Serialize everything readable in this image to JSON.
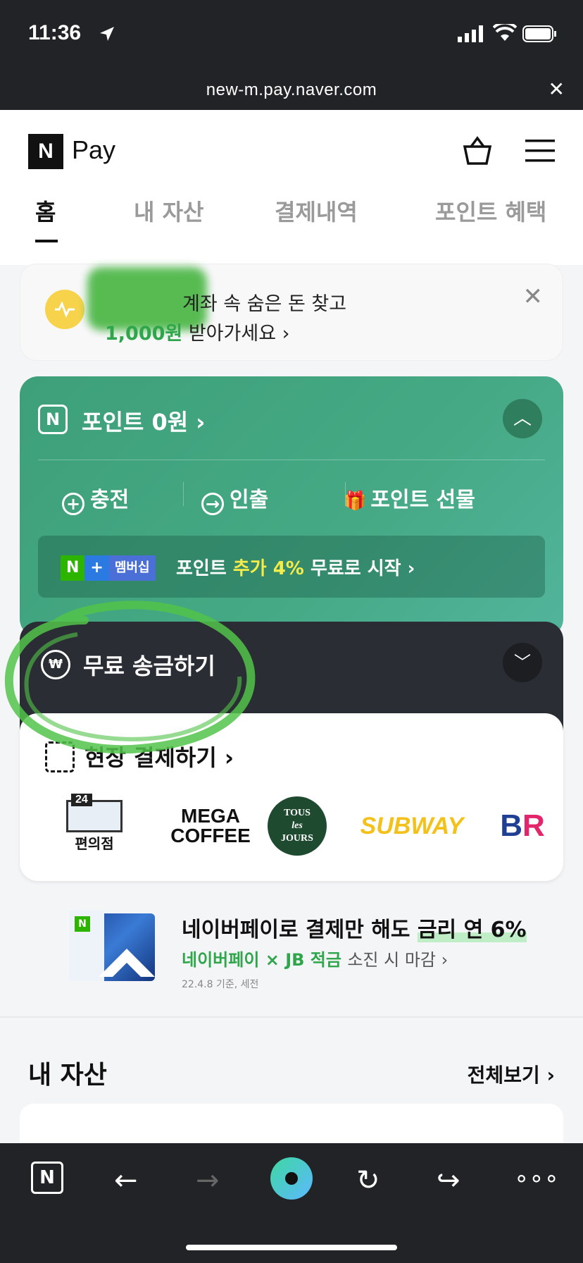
{
  "status": {
    "time": "11:36"
  },
  "browser": {
    "url": "new-m.pay.naver.com",
    "close_glyph": "✕"
  },
  "header": {
    "logo_mark": "N",
    "logo_text": "Pay"
  },
  "tabs": [
    "홈",
    "내 자산",
    "결제내역",
    "포인트 혜택"
  ],
  "banner": {
    "line1": "계좌 속 숨은 돈 찾고",
    "line2_amount": "1,000원",
    "line2_rest": "받아가세요 ›",
    "close_glyph": "✕"
  },
  "points": {
    "label": "포인트 0원 ›",
    "actions": [
      {
        "icon": "+",
        "label": "충전"
      },
      {
        "icon": "→",
        "label": "인출"
      },
      {
        "icon": "🎁",
        "label": "포인트 선물"
      }
    ],
    "promo": {
      "badge_n": "N",
      "badge_plus": "+",
      "badge_member": "멤버십",
      "text_pre": "포인트",
      "text_highlight": "추가 4%",
      "text_post": "무료로 시작 ›"
    }
  },
  "send": {
    "label": "무료 송금하기"
  },
  "pay": {
    "label": "현장 결제하기 ›",
    "brands": {
      "conv_tag": "24",
      "conv_label": "편의점",
      "mega_1": "MEGA",
      "mega_2": "COFFEE",
      "tous_1": "TOUS",
      "tous_2": "les",
      "tous_3": "JOURS",
      "subway": "SUBWAY",
      "br_1": "B",
      "br_2": "R"
    }
  },
  "ad": {
    "line1_pre": "네이버페이로 결제만 해도",
    "line1_highlight": "금리 연 6%",
    "line2_green": "네이버페이 × JB 적금",
    "line2_rest": "소진 시 마감 ›",
    "line3": "22.4.8 기준, 세전"
  },
  "assets": {
    "title": "내 자산",
    "view_all": "전체보기 ›"
  },
  "toolbar": {
    "n_label": "N",
    "back": "←",
    "forward": "→",
    "reload": "↻",
    "share": "↪",
    "more": "∘∘∘"
  },
  "colors": {
    "naver_green": "#2db400",
    "card_green": "#45a985",
    "dark": "#222326"
  }
}
